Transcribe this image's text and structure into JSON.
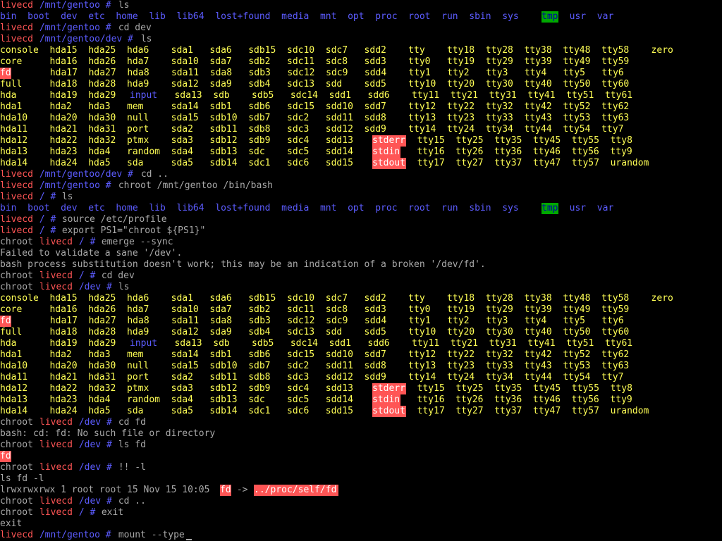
{
  "colors": {
    "background": "#000000",
    "text": "#a8a8a8",
    "prompt_host": "#ff5555",
    "path": "#5c5cff",
    "device": "#ffff55",
    "socket": "#ff55ff",
    "highlight_red": "#ff5555",
    "highlight_green": "#00a800"
  },
  "terminal": {
    "lines": [
      [
        [
          "livecd",
          "rb"
        ],
        [
          " /mnt/gentoo #",
          "bb"
        ],
        [
          " ls",
          "w"
        ]
      ],
      [
        [
          "bin  boot  dev  etc  home  lib  lib64  lost+found  media  mnt  opt  proc  root  run  sbin  sys  ",
          "bb"
        ],
        [
          "tmp",
          "g"
        ],
        [
          "  usr  var",
          "bb"
        ]
      ],
      [
        [
          "livecd",
          "rb"
        ],
        [
          " /mnt/gentoo #",
          "bb"
        ],
        [
          " cd dev",
          "w"
        ]
      ],
      [
        [
          "livecd",
          "rb"
        ],
        [
          " /mnt/gentoo/dev #",
          "bb"
        ],
        [
          " ls",
          "w"
        ]
      ],
      [
        [
          "console  hda15  hda25  hda6    sda1   sda6   sdb15  sdc10  sdc7   sdd2    tty    tty18  tty28  tty38  tty48  tty58    zero",
          "yb"
        ]
      ],
      [
        [
          "core     hda16  hda26  hda7    sda10  sda7   sdb2   sdc11  sdc8   sdd3    tty0   tty19  tty29  tty39  tty49  tty59",
          "yb"
        ]
      ],
      [
        [
          "fd",
          "r"
        ],
        [
          "       hda17  hda27  hda8    sda11  sda8   sdb3   sdc12  sdc9   sdd4    tty1   tty2   tty3   tty4   tty5   tty6",
          "yb"
        ]
      ],
      [
        [
          "full     hda18  hda28  hda9    sda12  sda9   sdb4   sdc13  sdd    sdd5    tty10  tty20  tty30  tty40  tty50  tty60",
          "yb"
        ]
      ],
      [
        [
          "hda      hda19  hda29  ",
          "yb"
        ],
        [
          "input",
          "bb"
        ],
        [
          "   sda13  sdb    sdb5   sdc14  sdd1   sdd6    tty11  tty21  tty31  tty41  tty51  tty61",
          "yb"
        ]
      ],
      [
        [
          "hda1     hda2   hda3   mem     sda14  sdb1   sdb6   sdc15  sdd10  sdd7    tty12  tty22  tty32  tty42  tty52  tty62",
          "yb"
        ]
      ],
      [
        [
          "hda10    hda20  hda30  null    sda15  sdb10  sdb7   sdc2   sdd11  sdd8    tty13  tty23  tty33  tty43  tty53  tty63",
          "yb"
        ]
      ],
      [
        [
          "hda11    hda21  hda31  port    sda2   sdb11  sdb8   sdc3   sdd12  sdd9    tty14  tty24  tty34  tty44  tty54  tty7",
          "yb"
        ]
      ],
      [
        [
          "hda12    hda22  hda32  ptmx    sda3   sdb12  sdb9   sdc4   sdd13  ",
          "yb"
        ],
        [
          "stderr",
          "r"
        ],
        [
          "  tty15  tty25  tty35  tty45  tty55  tty8",
          "yb"
        ]
      ],
      [
        [
          "hda13    hda23  hda4   random  sda4   sdb13  sdc    sdc5   sdd14  ",
          "yb"
        ],
        [
          "stdin",
          "r"
        ],
        [
          "   tty16  tty26  tty36  tty46  tty56  tty9",
          "yb"
        ]
      ],
      [
        [
          "hda14    hda24  hda5   sda     sda5   sdb14  sdc1   sdc6   sdd15  ",
          "yb"
        ],
        [
          "stdout",
          "r"
        ],
        [
          "  tty17  tty27  tty37  tty47  tty57  urandom",
          "yb"
        ]
      ],
      [
        [
          "livecd",
          "rb"
        ],
        [
          " /mnt/gentoo/dev #",
          "bb"
        ],
        [
          " cd ..",
          "w"
        ]
      ],
      [
        [
          "livecd",
          "rb"
        ],
        [
          " /mnt/gentoo #",
          "bb"
        ],
        [
          " chroot /mnt/gentoo /bin/bash",
          "w"
        ]
      ],
      [
        [
          "livecd",
          "rb"
        ],
        [
          " / #",
          "bb"
        ],
        [
          " ls",
          "w"
        ]
      ],
      [
        [
          "bin  boot  dev  etc  home  lib  lib64  lost+found  media  mnt  opt  proc  root  run  sbin  sys  ",
          "bb"
        ],
        [
          "tmp",
          "g"
        ],
        [
          "  usr  var",
          "bb"
        ]
      ],
      [
        [
          "livecd",
          "rb"
        ],
        [
          " / #",
          "bb"
        ],
        [
          " source /etc/profile",
          "w"
        ]
      ],
      [
        [
          "livecd",
          "rb"
        ],
        [
          " / #",
          "bb"
        ],
        [
          " export PS1=\"chroot ${PS1}\"",
          "w"
        ]
      ],
      [
        [
          "chroot ",
          "w"
        ],
        [
          "livecd",
          "rb"
        ],
        [
          " / #",
          "bb"
        ],
        [
          " emerge --sync",
          "w"
        ]
      ],
      [
        [
          "Failed to validate a sane '/dev'.",
          "w"
        ]
      ],
      [
        [
          "bash process substitution doesn't work; this may be an indication of a broken '/dev/fd'.",
          "w"
        ]
      ],
      [
        [
          "chroot ",
          "w"
        ],
        [
          "livecd",
          "rb"
        ],
        [
          " / #",
          "bb"
        ],
        [
          " cd dev",
          "w"
        ]
      ],
      [
        [
          "chroot ",
          "w"
        ],
        [
          "livecd",
          "rb"
        ],
        [
          " /dev #",
          "bb"
        ],
        [
          " ls",
          "w"
        ]
      ],
      [
        [
          "console  hda15  hda25  hda6    sda1   sda6   sdb15  sdc10  sdc7   sdd2    tty    tty18  tty28  tty38  tty48  tty58    zero",
          "yb"
        ]
      ],
      [
        [
          "core     hda16  hda26  hda7    sda10  sda7   sdb2   sdc11  sdc8   sdd3    tty0   tty19  tty29  tty39  tty49  tty59",
          "yb"
        ]
      ],
      [
        [
          "fd",
          "r"
        ],
        [
          "       hda17  hda27  hda8    sda11  sda8   sdb3   sdc12  sdc9   sdd4    tty1   tty2   tty3   tty4   tty5   tty6",
          "yb"
        ]
      ],
      [
        [
          "full     hda18  hda28  hda9    sda12  sda9   sdb4   sdc13  sdd    sdd5    tty10  tty20  tty30  tty40  tty50  tty60",
          "yb"
        ]
      ],
      [
        [
          "hda      hda19  hda29  ",
          "yb"
        ],
        [
          "input",
          "bb"
        ],
        [
          "   sda13  sdb    sdb5   sdc14  sdd1   sdd6    tty11  tty21  tty31  tty41  tty51  tty61",
          "yb"
        ]
      ],
      [
        [
          "hda1     hda2   hda3   mem     sda14  sdb1   sdb6   sdc15  sdd10  sdd7    tty12  tty22  tty32  tty42  tty52  tty62",
          "yb"
        ]
      ],
      [
        [
          "hda10    hda20  hda30  null    sda15  sdb10  sdb7   sdc2   sdd11  sdd8    tty13  tty23  tty33  tty43  tty53  tty63",
          "yb"
        ]
      ],
      [
        [
          "hda11    hda21  hda31  port    sda2   sdb11  sdb8   sdc3   sdd12  sdd9    tty14  tty24  tty34  tty44  tty54  tty7",
          "yb"
        ]
      ],
      [
        [
          "hda12    hda22  hda32  ptmx    sda3   sdb12  sdb9   sdc4   sdd13  ",
          "yb"
        ],
        [
          "stderr",
          "r"
        ],
        [
          "  tty15  tty25  tty35  tty45  tty55  tty8",
          "yb"
        ]
      ],
      [
        [
          "hda13    hda23  hda4   random  sda4   sdb13  sdc    sdc5   sdd14  ",
          "yb"
        ],
        [
          "stdin",
          "r"
        ],
        [
          "   tty16  tty26  tty36  tty46  tty56  tty9",
          "yb"
        ]
      ],
      [
        [
          "hda14    hda24  hda5   sda     sda5   sdb14  sdc1   sdc6   sdd15  ",
          "yb"
        ],
        [
          "stdout",
          "r"
        ],
        [
          "  tty17  tty27  tty37  tty47  tty57  urandom",
          "yb"
        ]
      ],
      [
        [
          "chroot ",
          "w"
        ],
        [
          "livecd",
          "rb"
        ],
        [
          " /dev #",
          "bb"
        ],
        [
          " cd fd",
          "w"
        ]
      ],
      [
        [
          "bash: cd: fd: No such file or directory",
          "w"
        ]
      ],
      [
        [
          "chroot ",
          "w"
        ],
        [
          "livecd",
          "rb"
        ],
        [
          " /dev #",
          "bb"
        ],
        [
          " ls fd",
          "w"
        ]
      ],
      [
        [
          "fd",
          "r"
        ]
      ],
      [
        [
          "chroot ",
          "w"
        ],
        [
          "livecd",
          "rb"
        ],
        [
          " /dev #",
          "bb"
        ],
        [
          " !! -l",
          "w"
        ]
      ],
      [
        [
          "ls fd -l",
          "w"
        ]
      ],
      [
        [
          "lrwxrwxrwx 1 root root 15 Nov 15 10:05 ",
          "w"
        ],
        [
          "fd",
          "r"
        ],
        [
          " -> ",
          "w"
        ],
        [
          "../proc/self/fd",
          "r"
        ]
      ],
      [
        [
          "chroot ",
          "w"
        ],
        [
          "livecd",
          "rb"
        ],
        [
          " /dev #",
          "bb"
        ],
        [
          " cd ..",
          "w"
        ]
      ],
      [
        [
          "chroot ",
          "w"
        ],
        [
          "livecd",
          "rb"
        ],
        [
          " / #",
          "bb"
        ],
        [
          " exit",
          "w"
        ]
      ],
      [
        [
          "exit",
          "w"
        ]
      ],
      [
        [
          "livecd",
          "rb"
        ],
        [
          " /mnt/gentoo #",
          "bb"
        ],
        [
          " mount --type",
          "w"
        ]
      ]
    ]
  }
}
